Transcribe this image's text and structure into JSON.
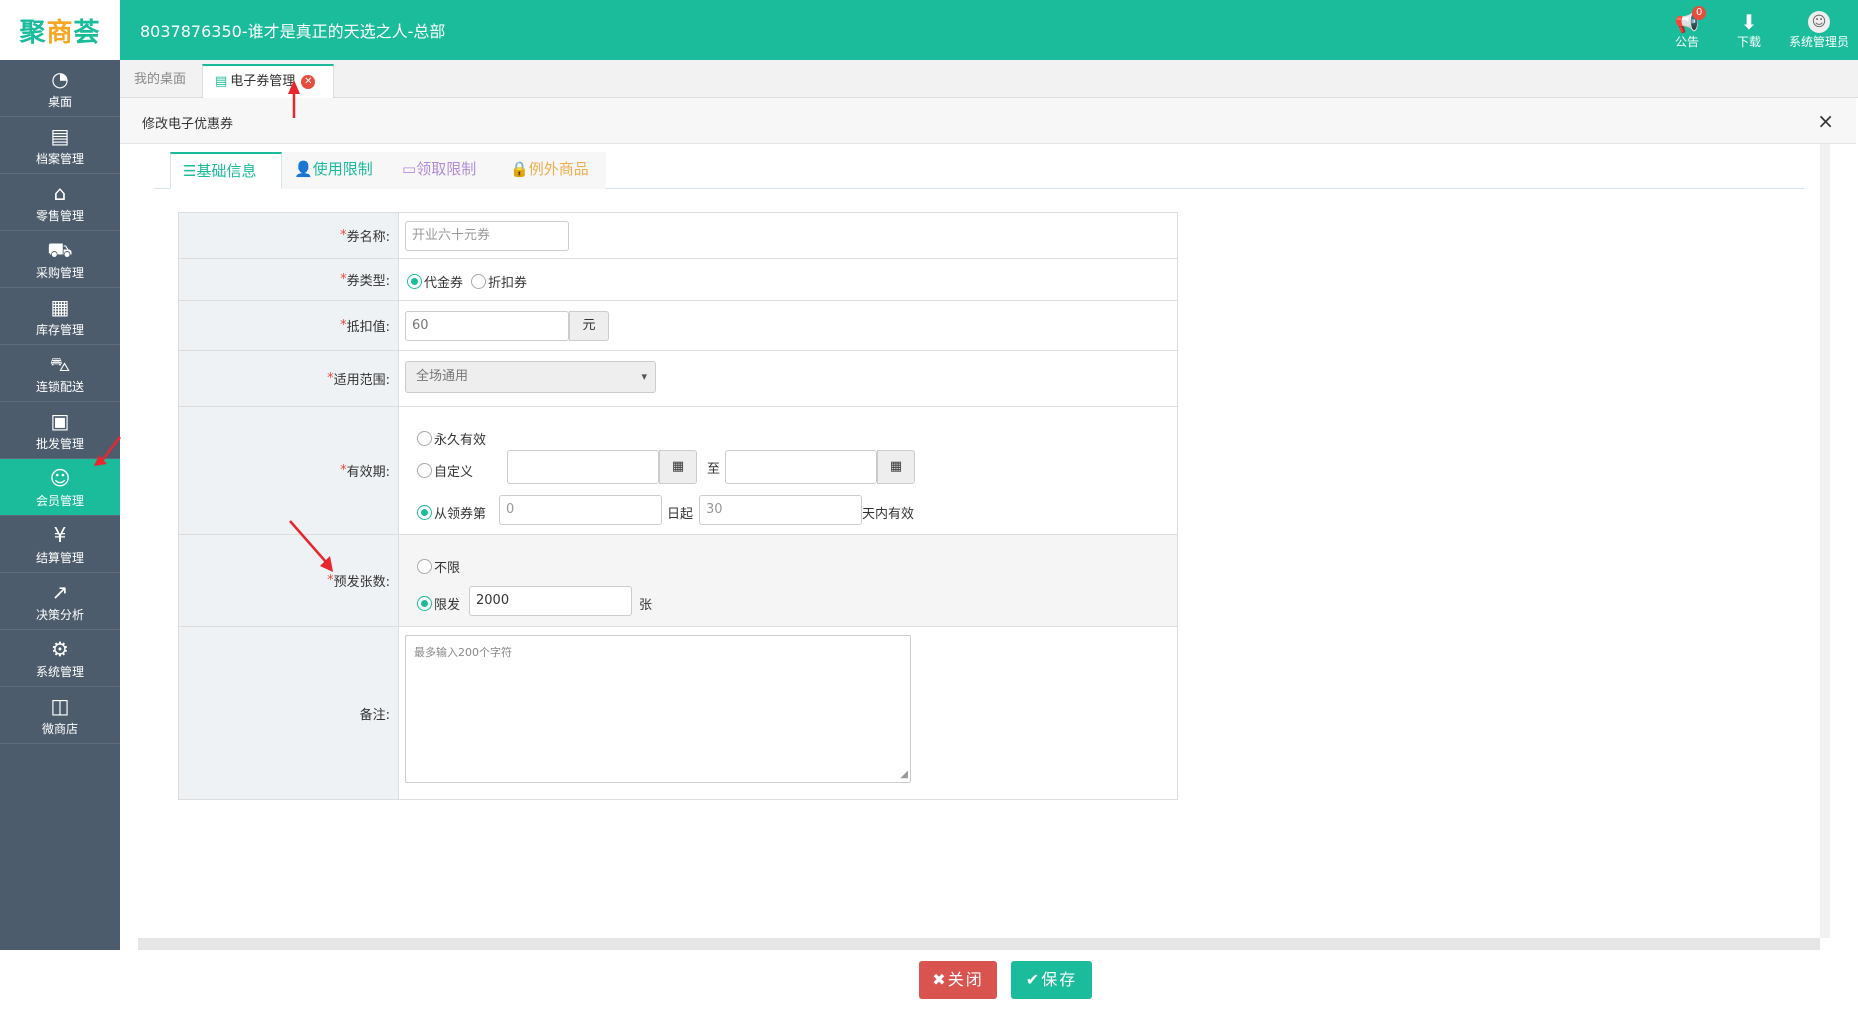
{
  "colors": {
    "brand": "#1abc9c",
    "sidebar": "#4d5c6c",
    "danger": "#d9534f",
    "required": "#e74c3c"
  },
  "logo": {
    "text_a": "聚",
    "text_b": "商",
    "text_c": "荟"
  },
  "app_title": "8037876350-谁才是真正的天选之人-总部",
  "top_actions": {
    "notice": {
      "icon": "megaphone-icon",
      "label": "公告",
      "badge": "0"
    },
    "download": {
      "icon": "download-icon",
      "label": "下载"
    },
    "user": {
      "icon": "avatar-icon",
      "label": "系统管理员"
    }
  },
  "sidebar": {
    "items": [
      {
        "label": "桌面",
        "icon": "dashboard-icon"
      },
      {
        "label": "档案管理",
        "icon": "archive-icon"
      },
      {
        "label": "零售管理",
        "icon": "store-icon"
      },
      {
        "label": "采购管理",
        "icon": "cart-icon"
      },
      {
        "label": "库存管理",
        "icon": "inventory-icon"
      },
      {
        "label": "连锁配送",
        "icon": "truck-icon"
      },
      {
        "label": "批发管理",
        "icon": "wholesale-icon"
      },
      {
        "label": "会员管理",
        "icon": "member-icon"
      },
      {
        "label": "结算管理",
        "icon": "settlement-icon"
      },
      {
        "label": "决策分析",
        "icon": "chart-icon"
      },
      {
        "label": "系统管理",
        "icon": "gear-icon"
      },
      {
        "label": "微商店",
        "icon": "shop-bag-icon"
      }
    ],
    "active": "会员管理"
  },
  "page_tabs": [
    {
      "label": "我的桌面"
    },
    {
      "label": "电子券管理",
      "icon": "document-icon",
      "closable": true
    }
  ],
  "dialog": {
    "title": "修改电子优惠券",
    "close_glyph": "×"
  },
  "form_tabs": [
    {
      "label": "基础信息",
      "icon": "list-icon"
    },
    {
      "label": "使用限制",
      "icon": "user-icon"
    },
    {
      "label": "领取限制",
      "icon": "card-icon"
    },
    {
      "label": "例外商品",
      "icon": "lock-icon"
    }
  ],
  "form": {
    "name": {
      "label": "券名称:",
      "placeholder": "开业六十元券"
    },
    "type": {
      "label": "券类型:",
      "options": [
        "代金券",
        "折扣券"
      ],
      "selected": "代金券"
    },
    "value": {
      "label": "抵扣值:",
      "value": "60",
      "unit": "元"
    },
    "scope": {
      "label": "适用范围:",
      "selected": "全场通用"
    },
    "validity": {
      "label": "有效期:",
      "opt_forever": "永久有效",
      "opt_custom": "自定义",
      "to_text": "至",
      "opt_from": "从领券第",
      "from_value": "0",
      "day_text": "日起",
      "days_value": "30",
      "days_suffix": "天内有效",
      "selected": "从领券第"
    },
    "quantity": {
      "label": "预发张数:",
      "opt_unlimited": "不限",
      "opt_limited": "限发",
      "limit_value": "2000",
      "unit": "张",
      "selected": "限发"
    },
    "remark": {
      "label": "备注:",
      "placeholder": "最多输入200个字符"
    }
  },
  "footer": {
    "close_label": "✖关闭",
    "save_label": "✔保存"
  }
}
